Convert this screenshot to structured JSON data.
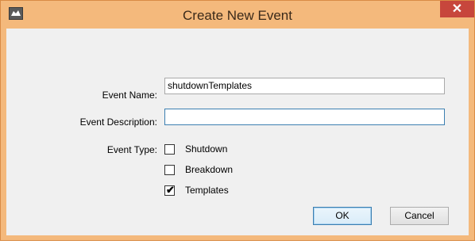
{
  "window": {
    "title": "Create New Event",
    "close_label": "✕"
  },
  "form": {
    "event_name_label": "Event Name:",
    "event_name_value": "shutdownTemplates",
    "event_description_label": "Event Description:",
    "event_description_value": "",
    "event_type_label": "Event Type:",
    "event_types": [
      {
        "label": "Shutdown",
        "checked": false
      },
      {
        "label": "Breakdown",
        "checked": false
      },
      {
        "label": "Templates",
        "checked": true
      }
    ]
  },
  "buttons": {
    "ok_label": "OK",
    "cancel_label": "Cancel"
  },
  "colors": {
    "frame": "#f4b97c",
    "close_button": "#c7463c",
    "client_background": "#f0f0f0",
    "focus_border": "#3c7fb1"
  }
}
